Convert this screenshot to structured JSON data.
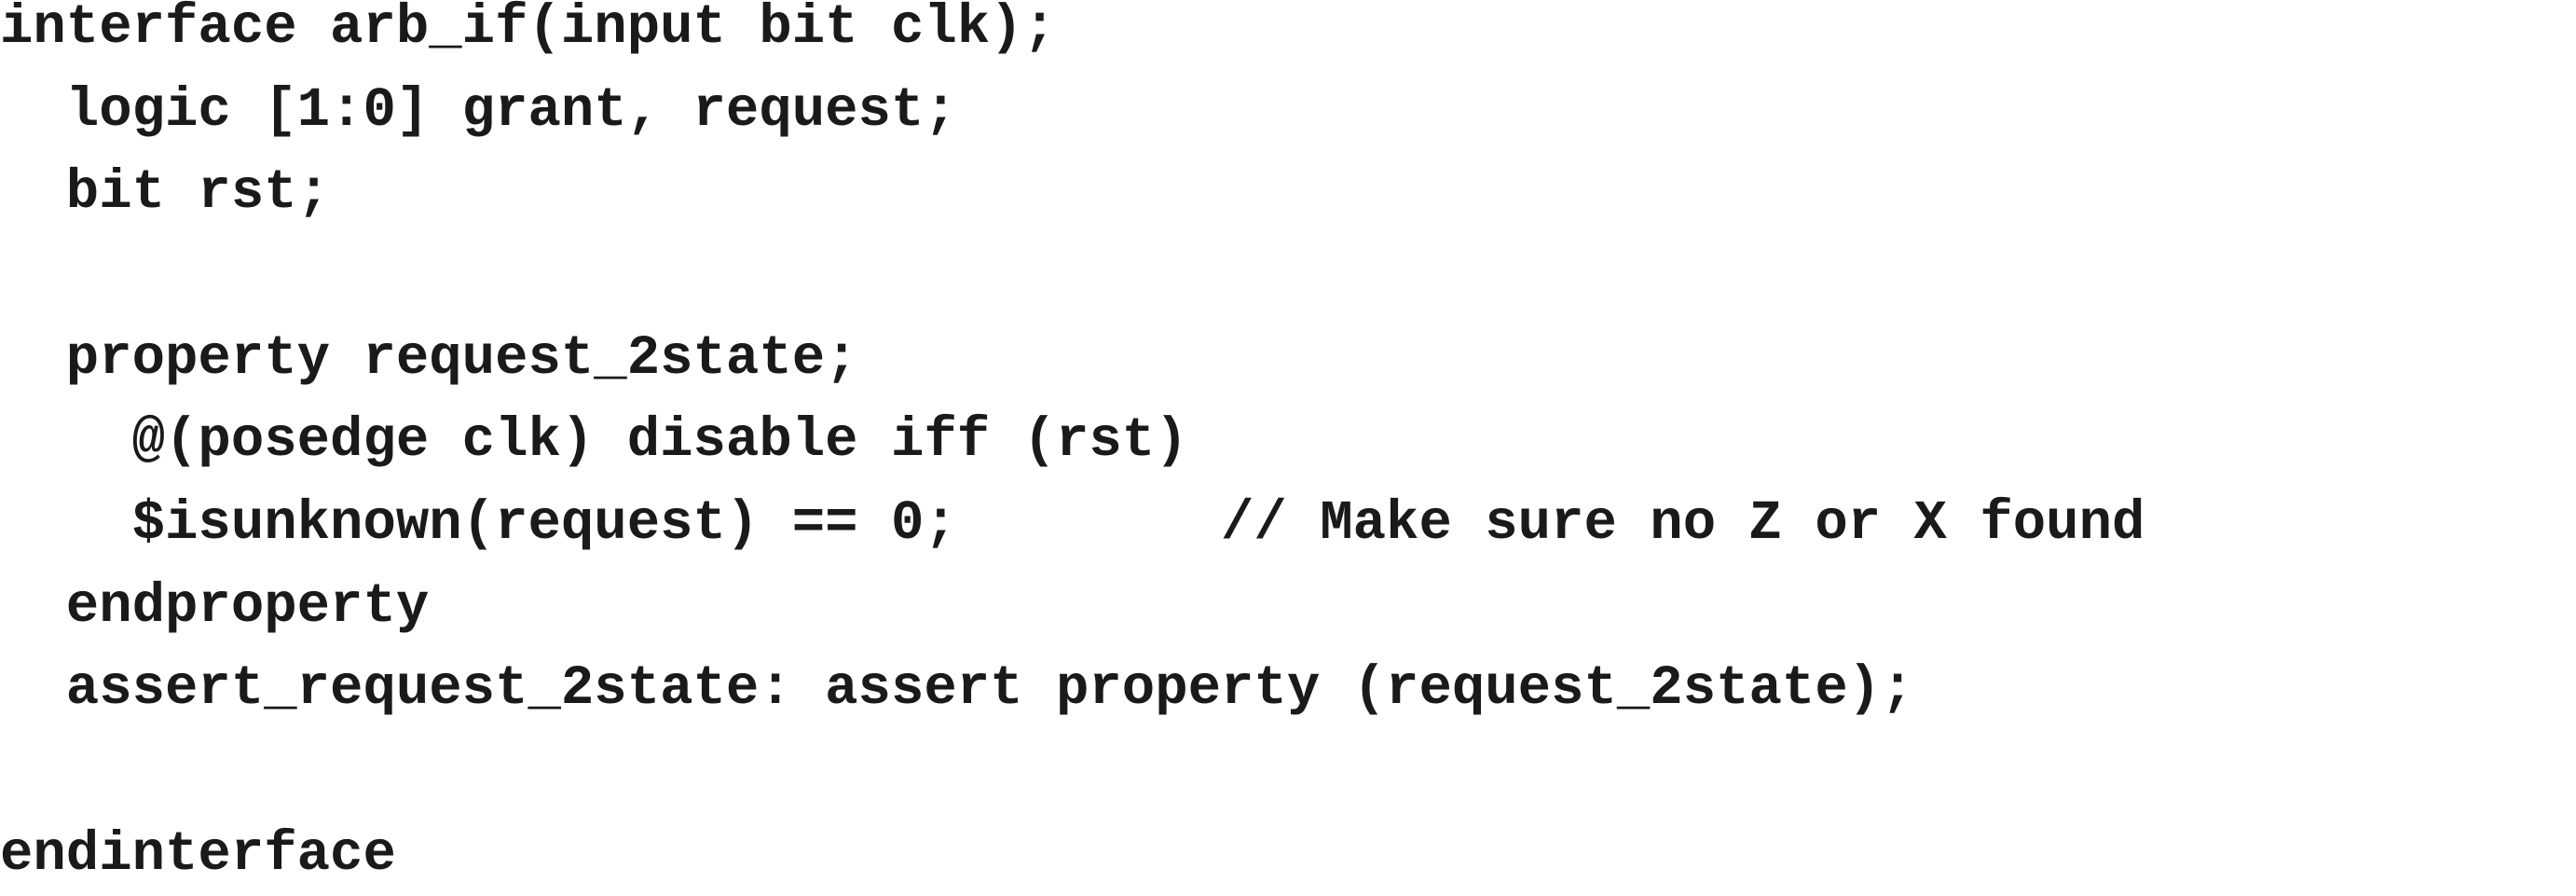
{
  "code": {
    "lines": [
      "interface arb_if(input bit clk);",
      "  logic [1:0] grant, request;",
      "  bit rst;",
      "",
      "  property request_2state;",
      "    @(posedge clk) disable iff (rst)",
      "    $isunknown(request) == 0;        // Make sure no Z or X found",
      "  endproperty",
      "  assert_request_2state: assert property (request_2state);",
      "",
      "endinterface"
    ]
  }
}
